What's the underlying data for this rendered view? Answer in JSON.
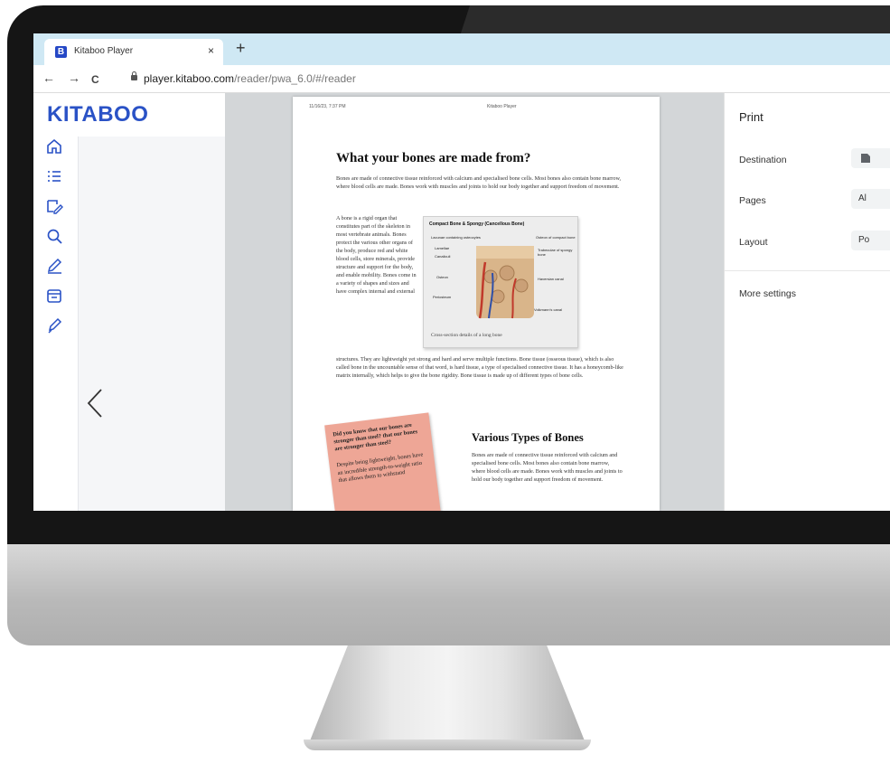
{
  "browser": {
    "tab_title": "Kitaboo Player",
    "favicon_letter": "B",
    "close_symbol": "×",
    "new_tab_symbol": "+",
    "back_symbol": "←",
    "forward_symbol": "→",
    "reload_symbol": "C",
    "url_host": "player.kitaboo.com",
    "url_path": "/reader/pwa_6.0/#/reader"
  },
  "app": {
    "logo": "KITABOO",
    "rail_icons": [
      "home-icon",
      "toc-icon",
      "notes-icon",
      "search-icon",
      "pen-icon",
      "archive-icon",
      "highlighter-icon"
    ]
  },
  "page": {
    "header_left": "11/16/23, 7:37 PM",
    "header_center": "Kitaboo Player",
    "heading": "What your bones are made from?",
    "intro": "Bones are made of connective tissue reinforced with calcium and specialised bone cells. Most bones also contain bone marrow, where blood cells are made. Bones work with muscles and joints to hold our body together and support freedom of movement.",
    "col_text": "A bone is a rigid organ that constitutes part of the skeleton in most vertebrate animals. Bones protect the various other organs of the body, produce red and white blood cells, store minerals, provide structure and support for the body, and enable mobility. Bones come in a variety of shapes and sizes and have complex internal and external",
    "continued_text": "structures. They are lightweight yet strong and hard and serve multiple functions. Bone tissue (osseous tissue), which is also called bone in the uncountable sense of that word, is hard tissue, a type of specialised connective tissue. It has a honeycomb-like matrix internally, which helps to give the bone rigidity. Bone tissue is made up of different types of bone cells.",
    "figure": {
      "title": "Compact Bone & Spongy (Cancellous Bone)",
      "labels": [
        "Lacunae containing osteocytes",
        "Lamellae",
        "Canaliculi",
        "Osteon",
        "Periosteum",
        "Osteon of compact bone",
        "Trabeculae of spongy bone",
        "Haversian canal",
        "Volkmann's canal"
      ],
      "caption": "Cross-section details of a long bone"
    },
    "note": {
      "title": "Did you know that our bones are stronger than steel? that our bones are stronger than steel?",
      "body": "Despite being lightweight, bones have an incredible strength-to-weight ratio that allows them to withstand"
    },
    "heading2": "Various Types of Bones",
    "col2_text": "Bones are made of connective tissue reinforced with calcium and specialised bone cells. Most bones also contain bone marrow, where blood cells are made. Bones work with muscles and joints to hold our body together and support freedom of movement."
  },
  "print": {
    "title": "Print",
    "destination_label": "Destination",
    "pages_label": "Pages",
    "pages_value": "Al",
    "layout_label": "Layout",
    "layout_value": "Po",
    "more_settings": "More settings"
  },
  "colors": {
    "brand": "#2a52c6",
    "tab_bar": "#cfe8f4",
    "reader_bg": "#d3d6d8",
    "note": "#eea696"
  }
}
